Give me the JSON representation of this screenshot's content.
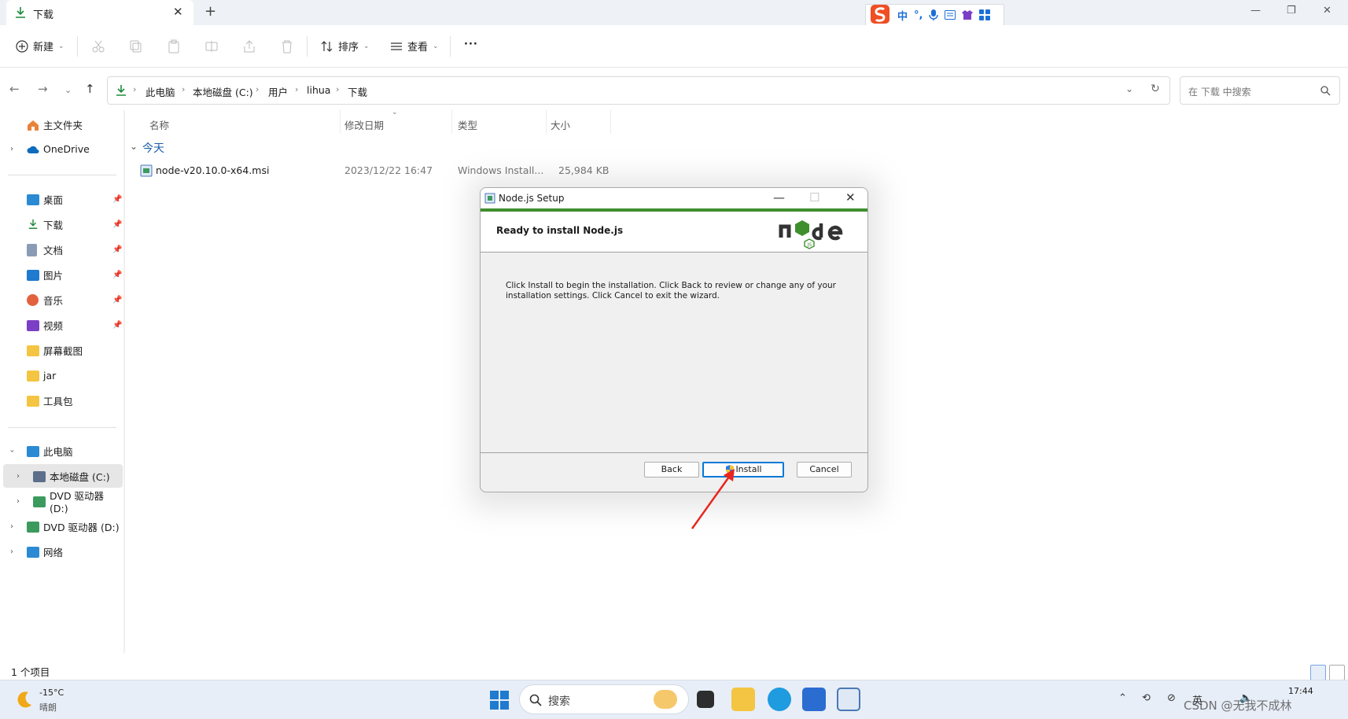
{
  "tab": {
    "title": "下载"
  },
  "ime": {
    "mode_label": "中",
    "punct_label": "°,"
  },
  "toolbar": {
    "new_label": "新建",
    "sort_label": "排序",
    "view_label": "查看",
    "more_label": "···"
  },
  "address": {
    "crumbs": [
      "此电脑",
      "本地磁盘 (C:)",
      "用户",
      "lihua",
      "下载"
    ]
  },
  "search": {
    "placeholder": "在 下载 中搜索"
  },
  "sidebar": {
    "home": "主文件夹",
    "onedrive": "OneDrive",
    "pinned": [
      "桌面",
      "下载",
      "文档",
      "图片",
      "音乐",
      "视频"
    ],
    "folders": [
      "屏幕截图",
      "jar",
      "工具包"
    ],
    "this_pc": "此电脑",
    "drives": [
      "本地磁盘 (C:)",
      "DVD 驱动器 (D:)",
      "DVD 驱动器 (D:) C"
    ],
    "network": "网络"
  },
  "columns": {
    "name": "名称",
    "modified": "修改日期",
    "type": "类型",
    "size": "大小"
  },
  "group": {
    "label": "今天"
  },
  "file": {
    "name": "node-v20.10.0-x64.msi",
    "modified": "2023/12/22 16:47",
    "type": "Windows Install...",
    "size": "25,984 KB"
  },
  "status": {
    "count": "1 个项目"
  },
  "dialog": {
    "title": "Node.js Setup",
    "heading": "Ready to install Node.js",
    "body": "Click Install to begin the installation. Click Back to review or change any of your installation settings. Click Cancel to exit the wizard.",
    "back": "Back",
    "install": "Install",
    "cancel": "Cancel",
    "logo_text": "node js"
  },
  "taskbar": {
    "weather_temp": "-15°C",
    "weather_desc": "晴朗",
    "search_label": "搜索",
    "ime_lang": "英",
    "time": "17:44"
  },
  "watermark": "CSDN @无我不成林",
  "colors": {
    "accent": "#0078d7",
    "node_green": "#3f8f2f",
    "folder_yellow": "#f4c542",
    "link_blue": "#1b5ea8"
  }
}
